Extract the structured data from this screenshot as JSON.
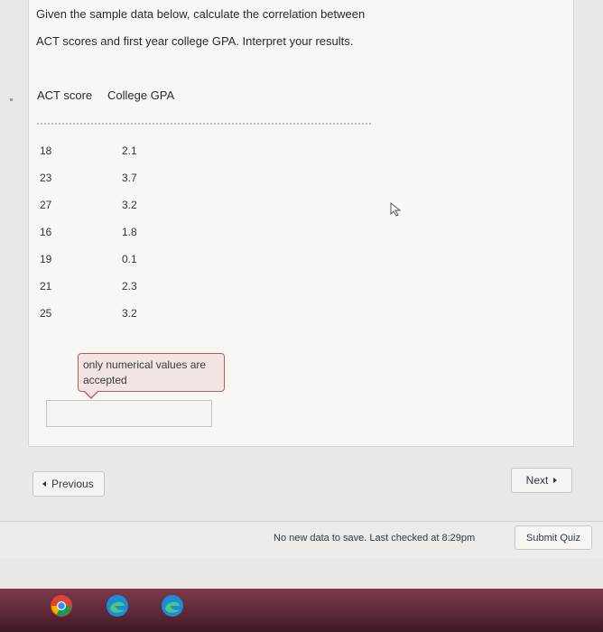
{
  "question": {
    "line1": "Given the sample data below, calculate the correlation between",
    "line2": "ACT scores and first year college GPA.  Interpret your results."
  },
  "table": {
    "headers": [
      "ACT score",
      "College GPA"
    ],
    "rows": [
      [
        "18",
        "2.1"
      ],
      [
        "23",
        "3.7"
      ],
      [
        "27",
        "3.2"
      ],
      [
        "16",
        "1.8"
      ],
      [
        "19",
        "0.1"
      ],
      [
        "21",
        "2.3"
      ],
      [
        "25",
        "3.2"
      ]
    ]
  },
  "validation": {
    "message": "only numerical values are accepted"
  },
  "answer": {
    "value": "",
    "placeholder": ""
  },
  "nav": {
    "previous_label": "Previous",
    "next_label": "Next"
  },
  "footer": {
    "status": "No new data to save. Last checked at 8:29pm",
    "submit_label": "Submit Quiz"
  },
  "taskbar": {
    "icons": [
      "chrome-icon",
      "edge-icon",
      "edge-icon"
    ]
  },
  "colors": {
    "tooltip_border": "#b85c5a",
    "tooltip_bg": "#f1e4e3",
    "taskbar": "#5b2736"
  }
}
